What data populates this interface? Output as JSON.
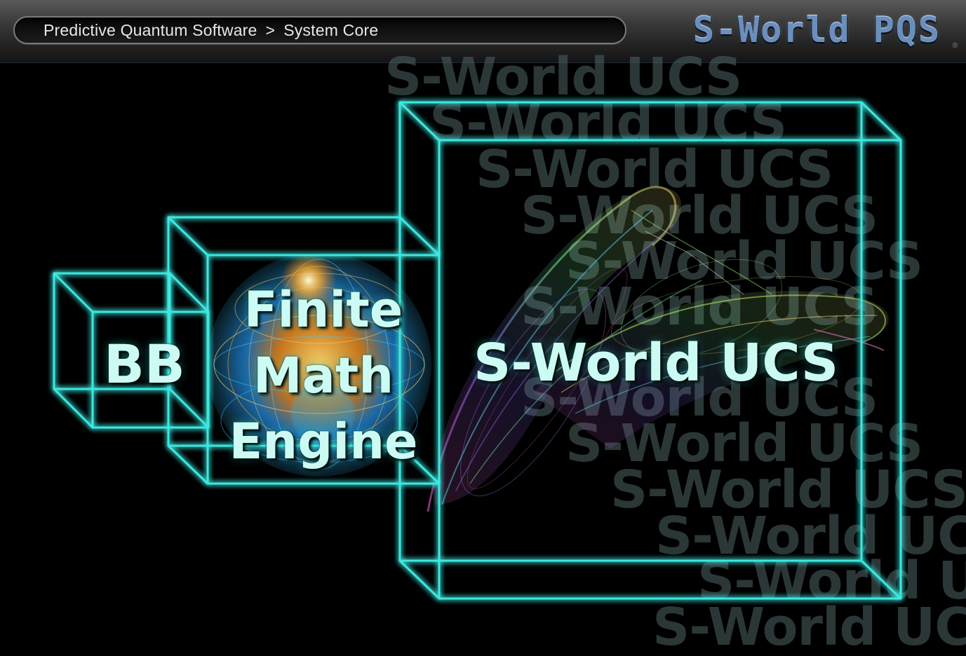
{
  "breadcrumb": {
    "root": "Predictive Quantum Software",
    "separator": ">",
    "current": "System Core"
  },
  "brand": {
    "name": "S-World PQS",
    "mark": "®"
  },
  "diagram": {
    "boxes": {
      "bb": {
        "label": "BB"
      },
      "finite_math_engine": {
        "lines": [
          "Finite",
          "Math",
          "Engine"
        ]
      },
      "ucs": {
        "label": "S-World UCS"
      }
    },
    "watermark": {
      "text": "S-World UCS",
      "repeat_count": 13
    },
    "wireframe_color": "#3de8e0",
    "label_color": "#ccfbf3"
  }
}
